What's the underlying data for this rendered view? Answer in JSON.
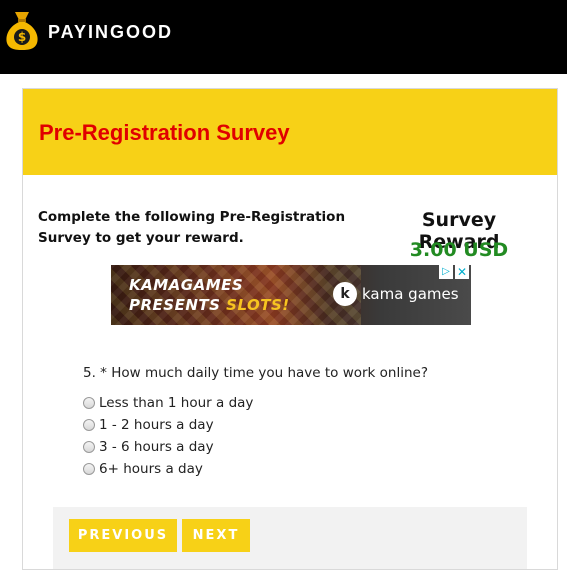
{
  "header": {
    "brand": "PAYINGOOD",
    "bg_color": "#000000",
    "logo_icon": "money-bag-icon"
  },
  "card": {
    "title": "Pre-Registration Survey",
    "title_color": "#e00000",
    "header_bg": "#f7d117",
    "intro": "Complete the following Pre-Registration Survey to get your reward.",
    "reward_label": "Survey Reward",
    "reward_value": "3.00 USD",
    "reward_color": "#228b22"
  },
  "ad": {
    "line1": "KAMAGAMES",
    "line2_prefix": "PRESENTS ",
    "line2_highlight": "SLOTS!",
    "logo_letter": "k",
    "brand": "kama games",
    "adchoices_icon": "adchoices-icon",
    "close_icon": "close-icon"
  },
  "question": {
    "text": "5. * How much daily time you have to work online?",
    "options": [
      "Less than 1 hour a day",
      "1 - 2 hours a day",
      "3 - 6 hours a day",
      "6+ hours a day"
    ]
  },
  "navigation": {
    "previous_label": "PREVIOUS",
    "next_label": "NEXT",
    "button_color": "#f7d117"
  }
}
